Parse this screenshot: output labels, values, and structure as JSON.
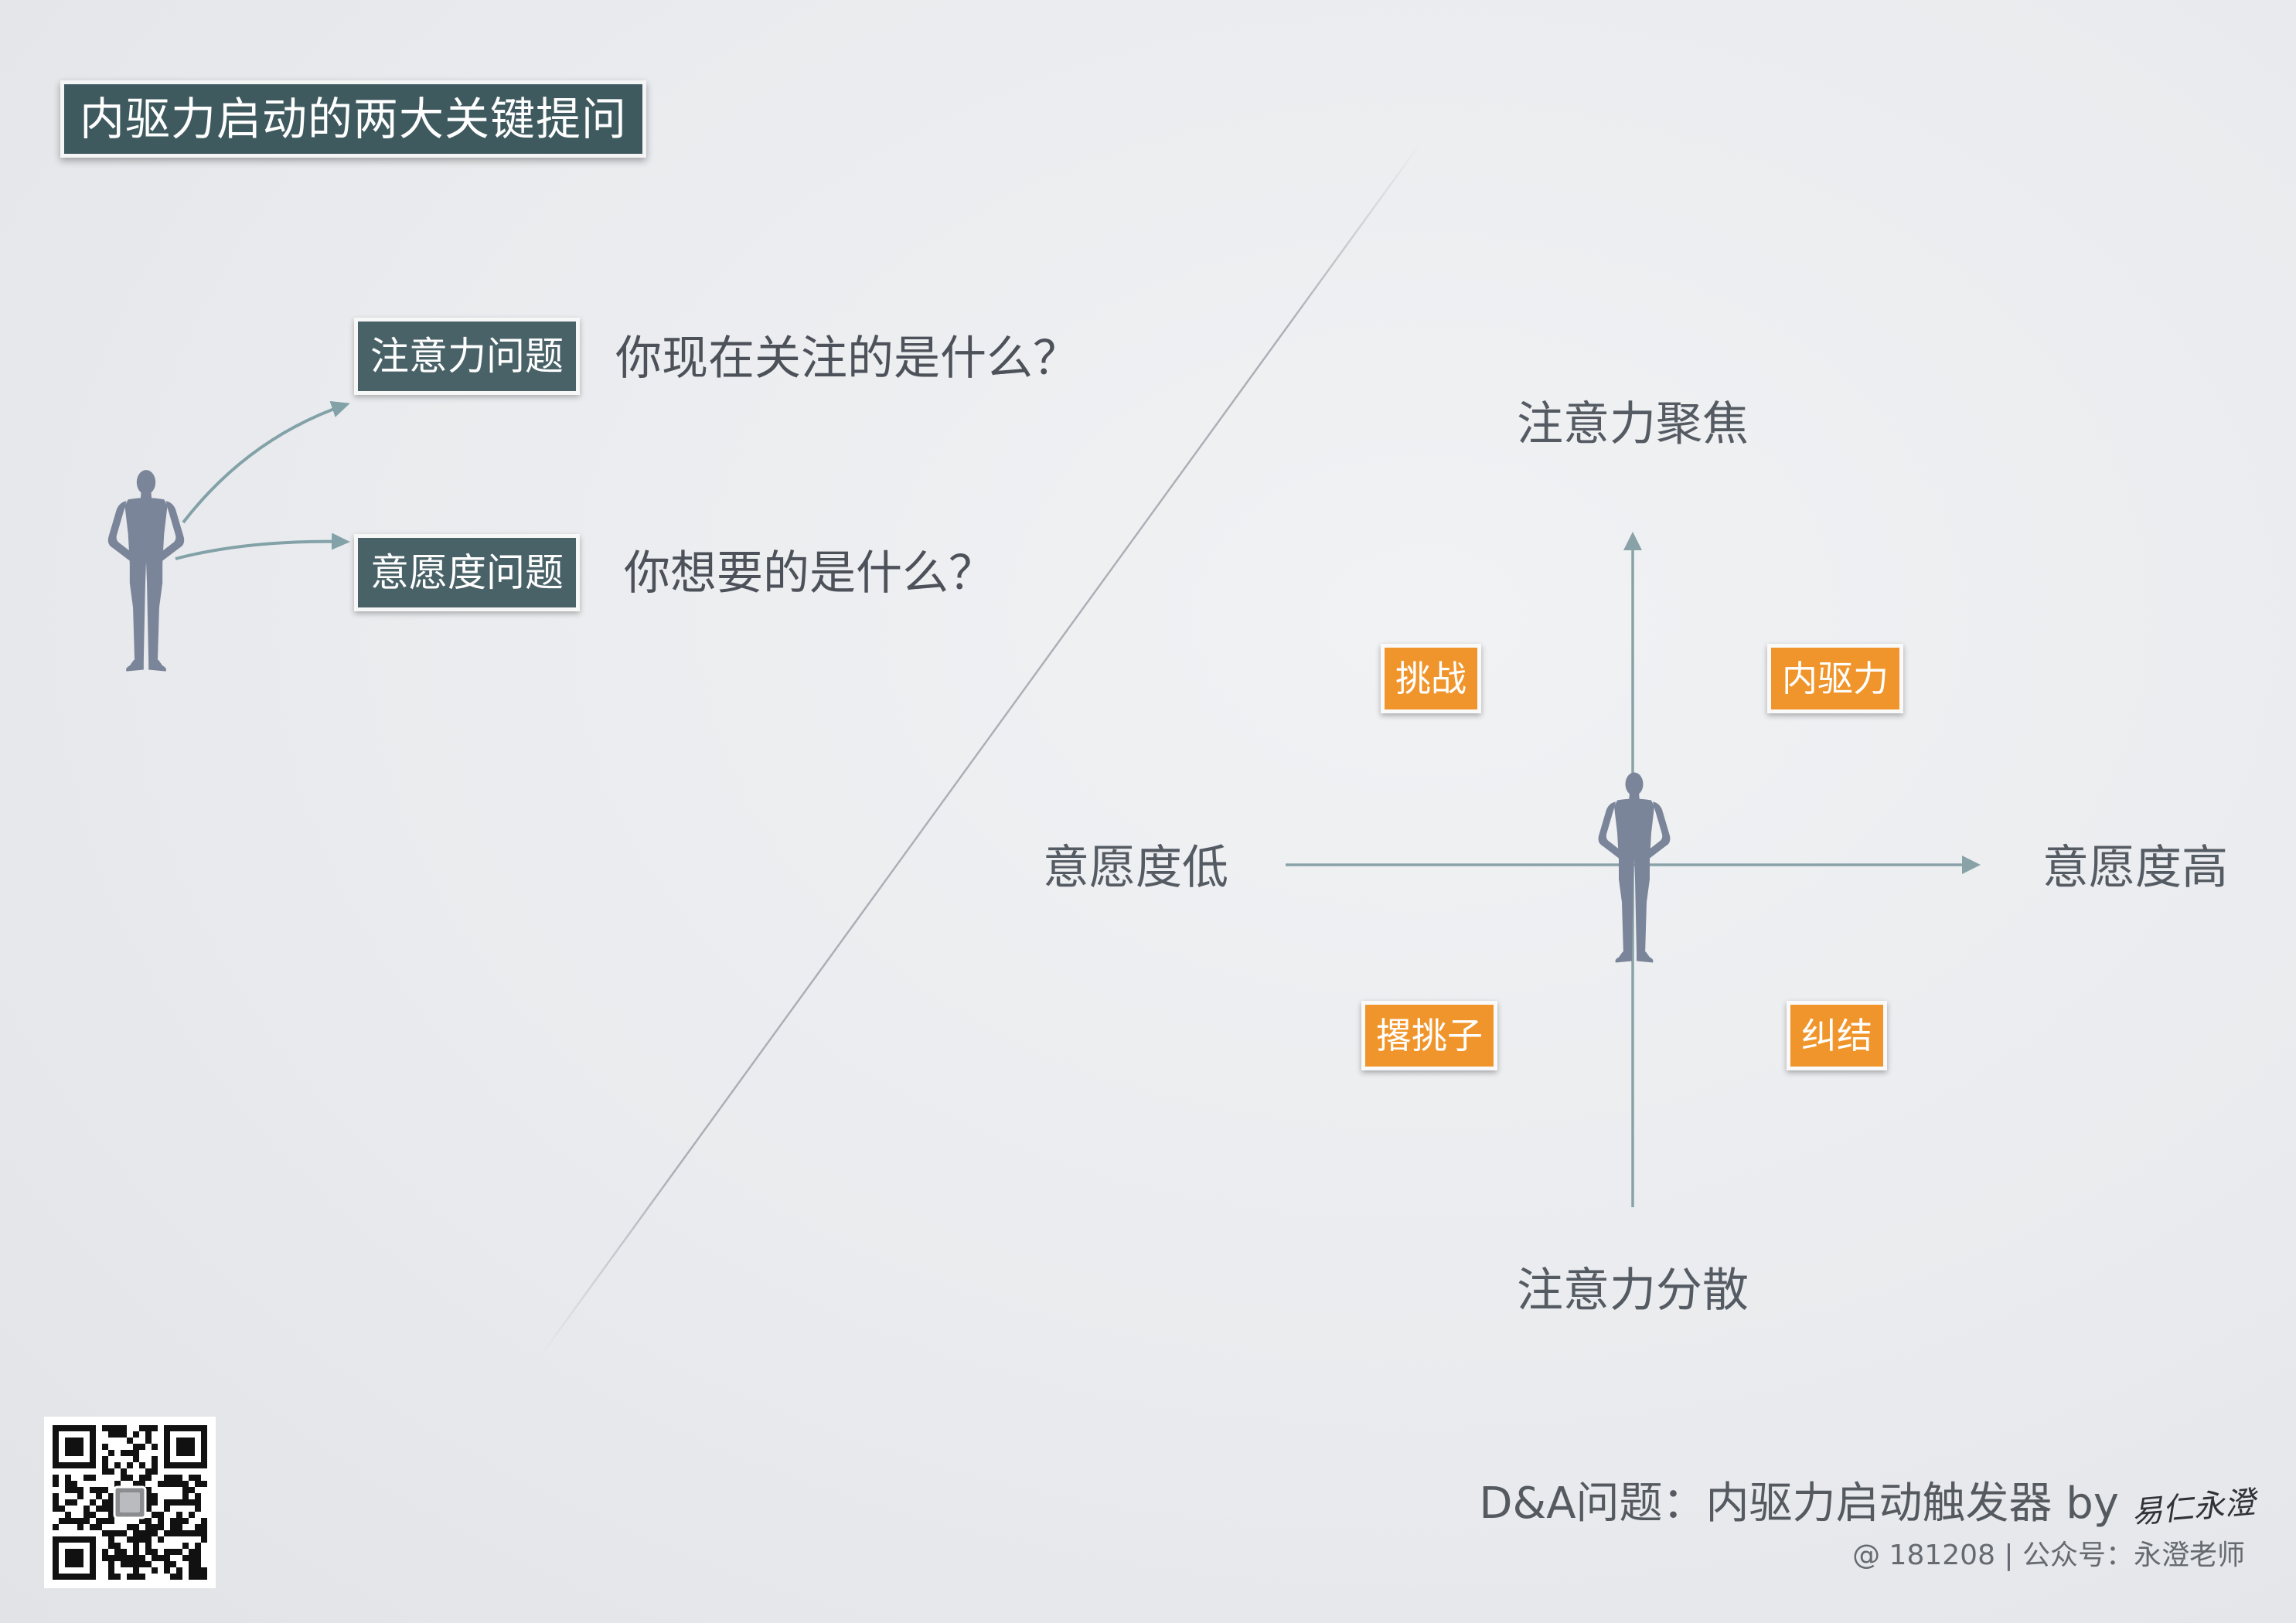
{
  "title": "内驱力启动的两大关键提问",
  "questions": [
    {
      "tag": "注意力问题",
      "text": "你现在关注的是什么？"
    },
    {
      "tag": "意愿度问题",
      "text": "你想要的是什么？"
    }
  ],
  "matrix": {
    "axis_top": "注意力聚焦",
    "axis_bottom": "注意力分散",
    "axis_left": "意愿度低",
    "axis_right": "意愿度高",
    "quadrants": {
      "top_left": "挑战",
      "top_right": "内驱力",
      "bottom_left": "撂挑子",
      "bottom_right": "纠结"
    }
  },
  "footer": {
    "title": "D&A问题：内驱力启动触发器 by",
    "signature": "易仁永澄",
    "meta": "@ 181208 | 公众号：永澄老师"
  },
  "icons": {
    "figure": "person-silhouette-icon",
    "qr": "qr-code-icon"
  },
  "colors": {
    "title-bg": "#3f5a5f",
    "tag-bg": "#496267",
    "quad-bg": "#f0952b",
    "figure": "#7b859a",
    "axis": "#88a2a7",
    "arrow": "#82a2a8",
    "diag": "#9aa0a8"
  }
}
